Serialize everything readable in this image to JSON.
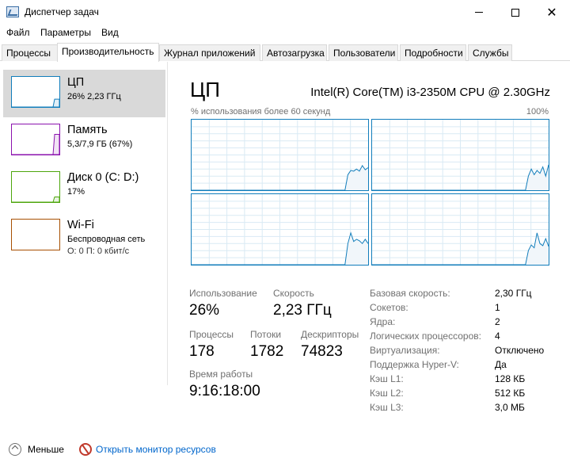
{
  "window": {
    "title": "Диспетчер задач"
  },
  "menu": [
    "Файл",
    "Параметры",
    "Вид"
  ],
  "tabs": [
    "Процессы",
    "Производительность",
    "Журнал приложений",
    "Автозагрузка",
    "Пользователи",
    "Подробности",
    "Службы"
  ],
  "sidebar": {
    "items": [
      {
        "name": "ЦП",
        "line1": "26% 2,23 ГГц",
        "line2": "",
        "color": "#117dbb",
        "level": 0.26
      },
      {
        "name": "Память",
        "line1": "5,3/7,9 ГБ (67%)",
        "line2": "",
        "color": "#8b12ae",
        "level": 0.67
      },
      {
        "name": "Диск 0 (C: D:)",
        "line1": "17%",
        "line2": "",
        "color": "#4da60c",
        "level": 0.17
      },
      {
        "name": "Wi-Fi",
        "line1": "Беспроводная сеть",
        "line2": "О: 0 П: 0 кбит/с",
        "color": "#a74f01",
        "level": 0
      }
    ]
  },
  "cpu": {
    "title": "ЦП",
    "model": "Intel(R) Core(TM) i3-2350M CPU @ 2.30GHz",
    "graph_caption": "% использования более 60 секунд",
    "graph_max": "100%",
    "graph_color": "#117dbb",
    "grid_color": "#d9eaf4",
    "fill_color": "#f1f6fa",
    "core_graphs": [
      [
        0,
        0,
        0,
        0,
        0,
        0,
        0,
        0,
        0,
        0,
        0,
        0,
        0,
        0,
        0,
        0,
        0,
        0,
        0,
        0,
        0,
        0,
        0,
        0,
        0,
        0,
        0,
        0,
        0,
        0,
        0,
        0,
        0,
        0,
        0,
        0,
        0,
        0,
        0,
        0,
        0,
        0,
        0,
        0,
        0,
        0,
        0,
        0,
        0,
        0,
        0,
        0,
        0,
        0,
        0.22,
        0.28,
        0.27,
        0.3,
        0.27,
        0.35,
        0.29,
        0.32
      ],
      [
        0,
        0,
        0,
        0,
        0,
        0,
        0,
        0,
        0,
        0,
        0,
        0,
        0,
        0,
        0,
        0,
        0,
        0,
        0,
        0,
        0,
        0,
        0,
        0,
        0,
        0,
        0,
        0,
        0,
        0,
        0,
        0,
        0,
        0,
        0,
        0,
        0,
        0,
        0,
        0,
        0,
        0,
        0,
        0,
        0,
        0,
        0,
        0,
        0,
        0,
        0,
        0,
        0,
        0,
        0.2,
        0.3,
        0.22,
        0.28,
        0.24,
        0.33,
        0.2,
        0.36
      ],
      [
        0,
        0,
        0,
        0,
        0,
        0,
        0,
        0,
        0,
        0,
        0,
        0,
        0,
        0,
        0,
        0,
        0,
        0,
        0,
        0,
        0,
        0,
        0,
        0,
        0,
        0,
        0,
        0,
        0,
        0,
        0,
        0,
        0,
        0,
        0,
        0,
        0,
        0,
        0,
        0,
        0,
        0,
        0,
        0,
        0,
        0,
        0,
        0,
        0,
        0,
        0,
        0,
        0,
        0,
        0.3,
        0.45,
        0.33,
        0.36,
        0.34,
        0.3,
        0.36,
        0.3
      ],
      [
        0,
        0,
        0,
        0,
        0,
        0,
        0,
        0,
        0,
        0,
        0,
        0,
        0,
        0,
        0,
        0,
        0,
        0,
        0,
        0,
        0,
        0,
        0,
        0,
        0,
        0,
        0,
        0,
        0,
        0,
        0,
        0,
        0,
        0,
        0,
        0,
        0,
        0,
        0,
        0,
        0,
        0,
        0,
        0,
        0,
        0,
        0,
        0,
        0,
        0,
        0,
        0,
        0,
        0,
        0.2,
        0.28,
        0.24,
        0.45,
        0.3,
        0.27,
        0.37,
        0.26
      ]
    ],
    "stats": {
      "usage_label": "Использование",
      "usage_value": "26%",
      "speed_label": "Скорость",
      "speed_value": "2,23 ГГц",
      "processes_label": "Процессы",
      "processes_value": "178",
      "threads_label": "Потоки",
      "threads_value": "1782",
      "handles_label": "Дескрипторы",
      "handles_value": "74823",
      "uptime_label": "Время работы",
      "uptime_value": "9:16:18:00"
    },
    "specs": [
      {
        "key": "Базовая скорость:",
        "value": "2,30 ГГц"
      },
      {
        "key": "Сокетов:",
        "value": "1"
      },
      {
        "key": "Ядра:",
        "value": "2"
      },
      {
        "key": "Логических процессоров:",
        "value": "4"
      },
      {
        "key": "Виртуализация:",
        "value": "Отключено"
      },
      {
        "key": "Поддержка Hyper-V:",
        "value": "Да"
      },
      {
        "key": "Кэш L1:",
        "value": "128 КБ"
      },
      {
        "key": "Кэш L2:",
        "value": "512 КБ"
      },
      {
        "key": "Кэш L3:",
        "value": "3,0 МБ"
      }
    ]
  },
  "footer": {
    "less_label": "Меньше",
    "monitor_link": "Открыть монитор ресурсов"
  }
}
